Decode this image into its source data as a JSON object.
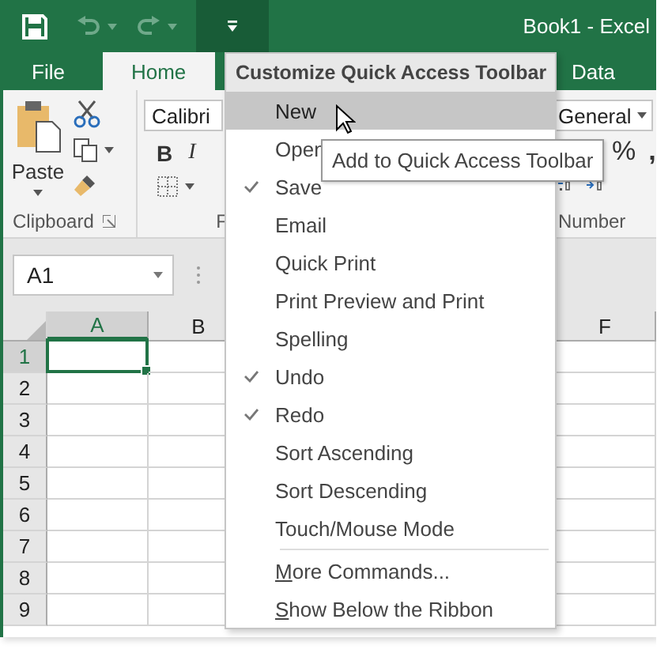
{
  "title_bar": {
    "title": "Book1 - Excel",
    "quick_access": [
      {
        "kind": "save",
        "disabled": false
      },
      {
        "kind": "undo",
        "disabled": true
      },
      {
        "kind": "redo",
        "disabled": true
      }
    ],
    "customize_pressed": true
  },
  "tabs": [
    {
      "label": "File",
      "selected": false
    },
    {
      "label": "Home",
      "selected": true
    },
    {
      "label": "Data",
      "selected": false
    }
  ],
  "ribbon": {
    "clipboard": {
      "paste": "Paste",
      "group_label": "Clipboard"
    },
    "font": {
      "font_name": "Calibri",
      "bold": "B",
      "italic": "I",
      "group_label": "F"
    },
    "number": {
      "format": "General",
      "percent": "%",
      "comma": ",",
      "group_label": "Number"
    }
  },
  "name_box": {
    "value": "A1"
  },
  "grid": {
    "columns": [
      {
        "label": "A",
        "selected": true
      },
      {
        "label": "B",
        "selected": false
      },
      {
        "label": "F",
        "selected": false
      }
    ],
    "rows": [
      {
        "label": "1",
        "selected": true
      },
      {
        "label": "2",
        "selected": false
      },
      {
        "label": "3",
        "selected": false
      },
      {
        "label": "4",
        "selected": false
      },
      {
        "label": "5",
        "selected": false
      },
      {
        "label": "6",
        "selected": false
      },
      {
        "label": "7",
        "selected": false
      },
      {
        "label": "8",
        "selected": false
      },
      {
        "label": "9",
        "selected": false
      }
    ]
  },
  "menu": {
    "title": "Customize Quick Access Toolbar",
    "items": [
      {
        "kind": "option",
        "label": "New",
        "checked": false,
        "selected": true
      },
      {
        "kind": "option",
        "label": "Open",
        "checked": false,
        "selected": false
      },
      {
        "kind": "option",
        "label": "Save",
        "checked": true,
        "selected": false
      },
      {
        "kind": "option",
        "label": "Email",
        "checked": false,
        "selected": false
      },
      {
        "kind": "option",
        "label": "Quick Print",
        "checked": false,
        "selected": false
      },
      {
        "kind": "option",
        "label": "Print Preview and Print",
        "checked": false,
        "selected": false
      },
      {
        "kind": "option",
        "label": "Spelling",
        "checked": false,
        "selected": false
      },
      {
        "kind": "option",
        "label": "Undo",
        "checked": true,
        "selected": false
      },
      {
        "kind": "option",
        "label": "Redo",
        "checked": true,
        "selected": false
      },
      {
        "kind": "option",
        "label": "Sort Ascending",
        "checked": false,
        "selected": false
      },
      {
        "kind": "option",
        "label": "Sort Descending",
        "checked": false,
        "selected": false
      },
      {
        "kind": "option",
        "label": "Touch/Mouse Mode",
        "checked": false,
        "selected": false
      },
      {
        "kind": "command",
        "label": "More Commands...",
        "selected": false
      },
      {
        "kind": "command",
        "label": "Show Below the Ribbon",
        "selected": false
      }
    ]
  },
  "tooltip": {
    "text": "Add to Quick Access Toolbar"
  }
}
